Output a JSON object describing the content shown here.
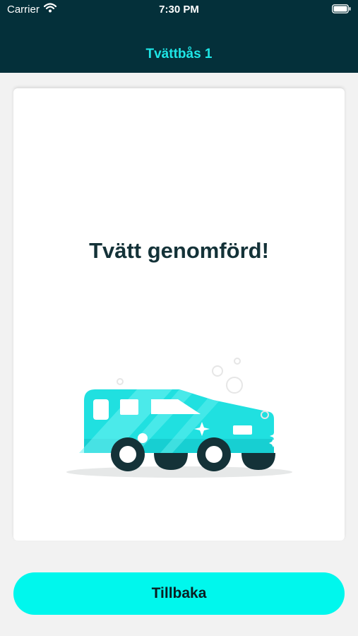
{
  "status_bar": {
    "carrier": "Carrier",
    "time": "7:30 PM",
    "icons": [
      "wifi-icon",
      "battery-icon"
    ]
  },
  "header": {
    "title": "Tvättbås 1",
    "background_color": "#04303a",
    "title_color": "#1ee6e6"
  },
  "card": {
    "message": "Tvätt genomförd!",
    "illustration": "washed-car-illustration"
  },
  "footer": {
    "back_label": "Tillbaka",
    "button_color": "#00f7ed"
  }
}
